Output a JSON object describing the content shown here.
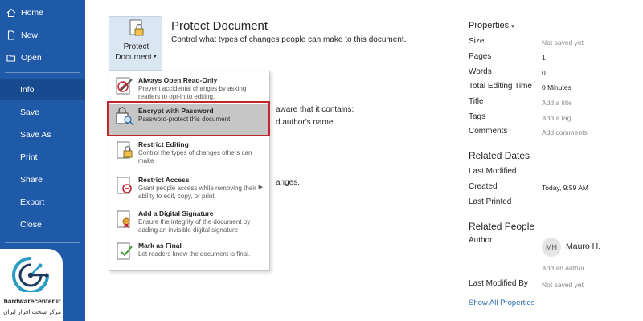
{
  "sidebar": {
    "items": [
      {
        "label": "Home",
        "icon": "home-icon"
      },
      {
        "label": "New",
        "icon": "new-document-icon"
      },
      {
        "label": "Open",
        "icon": "folder-open-icon"
      },
      {
        "label": "Info",
        "active": true
      },
      {
        "label": "Save"
      },
      {
        "label": "Save As"
      },
      {
        "label": "Print"
      },
      {
        "label": "Share"
      },
      {
        "label": "Export"
      },
      {
        "label": "Close"
      }
    ]
  },
  "logo": {
    "name": "hardwarecenter.ir",
    "subtitle": "مرکز سخت افزار ایران"
  },
  "protect": {
    "button_line1": "Protect",
    "button_line2": "Document",
    "title": "Protect Document",
    "description": "Control what types of changes people can make to this document."
  },
  "partially_hidden": {
    "line1": "aware that it contains:",
    "line2": "d author's name",
    "line3": "anges."
  },
  "menu": {
    "items": [
      {
        "title": "Always Open Read-Only",
        "description": "Prevent accidental changes by asking readers to opt-in to editing.",
        "icon": "read-only-pen-icon"
      },
      {
        "title": "Encrypt with Password",
        "description": "Password-protect this document",
        "icon": "lock-key-icon",
        "highlighted": true
      },
      {
        "title": "Restrict Editing",
        "description": "Control the types of changes others can make",
        "icon": "restrict-editing-icon"
      },
      {
        "title": "Restrict Access",
        "description": "Grant people access while removing their ability to edit, copy, or print.",
        "icon": "restrict-access-icon",
        "has_submenu": true
      },
      {
        "title": "Add a Digital Signature",
        "description": "Ensure the integrity of the document by adding an invisible digital signature",
        "icon": "digital-signature-icon"
      },
      {
        "title": "Mark as Final",
        "description": "Let readers know the document is final.",
        "icon": "mark-final-icon"
      }
    ]
  },
  "properties": {
    "title": "Properties",
    "rows": [
      {
        "label": "Size",
        "value": "Not saved yet",
        "muted": true
      },
      {
        "label": "Pages",
        "value": "1"
      },
      {
        "label": "Words",
        "value": "0"
      },
      {
        "label": "Total Editing Time",
        "value": "0 Minutes"
      },
      {
        "label": "Title",
        "value": "Add a title",
        "muted": true
      },
      {
        "label": "Tags",
        "value": "Add a tag",
        "muted": true
      },
      {
        "label": "Comments",
        "value": "Add comments",
        "muted": true
      }
    ]
  },
  "related_dates": {
    "heading": "Related Dates",
    "last_modified_label": "Last Modified",
    "created_label": "Created",
    "created_value": "Today, 9:59 AM",
    "last_printed_label": "Last Printed"
  },
  "related_people": {
    "heading": "Related People",
    "author_label": "Author",
    "author_initials": "MH",
    "author_name": "Mauro H.",
    "add_author": "Add an author",
    "last_modified_by_label": "Last Modified By",
    "last_modified_by_value": "Not saved yet",
    "show_all": "Show All Properties"
  },
  "colors": {
    "sidebar": "#1f5aa8",
    "sidebar_active": "#174a8f",
    "highlight": "#c6c6c6",
    "outline": "#c0262e",
    "link": "#2b6cb0"
  }
}
